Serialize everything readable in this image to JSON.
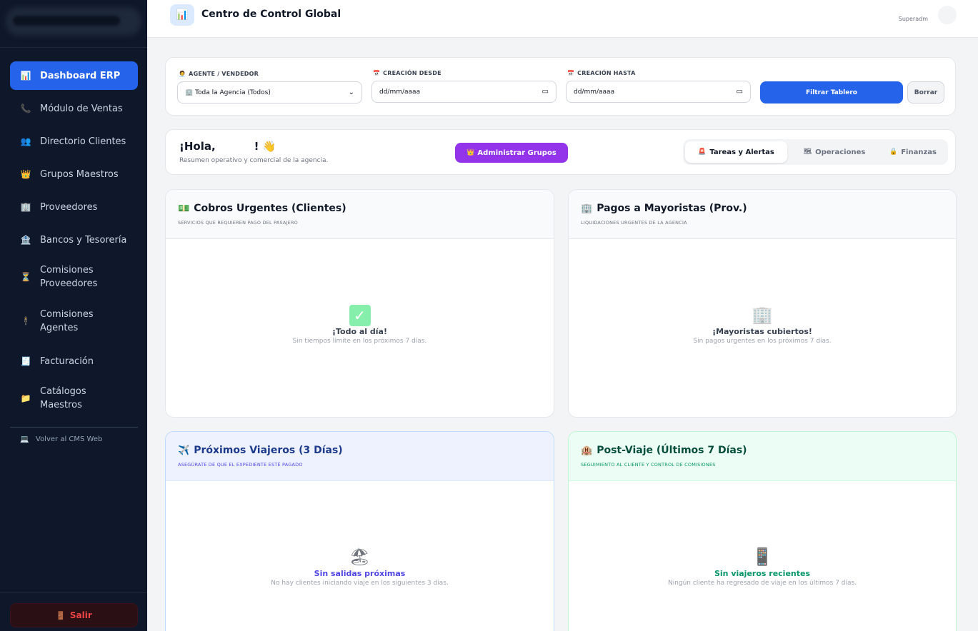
{
  "sidebar": {
    "items": [
      {
        "icon": "bar-chart-icon",
        "glyph": "📊",
        "label": "Dashboard ERP",
        "active": true
      },
      {
        "icon": "phone-icon",
        "glyph": "📞",
        "label": "Módulo de Ventas"
      },
      {
        "icon": "people-icon",
        "glyph": "👥",
        "label": "Directorio Clientes"
      },
      {
        "icon": "crown-icon",
        "glyph": "👑",
        "label": "Grupos Maestros"
      },
      {
        "icon": "building-icon",
        "glyph": "🏢",
        "label": "Proveedores"
      },
      {
        "icon": "bank-icon",
        "glyph": "🏦",
        "label": "Bancos y Tesorería"
      },
      {
        "icon": "hourglass-icon",
        "glyph": "⏳",
        "label": "Comisiones Proveedores"
      },
      {
        "icon": "agent-icon",
        "glyph": "🕴",
        "label": "Comisiones Agentes"
      },
      {
        "icon": "receipt-icon",
        "glyph": "🧾",
        "label": "Facturación"
      },
      {
        "icon": "folder-icon",
        "glyph": "📁",
        "label": "Catálogos Maestros"
      }
    ],
    "back_link": {
      "icon": "computer-icon",
      "glyph": "💻",
      "label": "Volver al CMS Web"
    },
    "logout": {
      "icon": "door-icon",
      "glyph": "🚪",
      "label": "Salir"
    }
  },
  "header": {
    "icon": "bar-chart-icon",
    "glyph": "📊",
    "title": "Centro de Control Global",
    "user_role": "Superadm"
  },
  "filters": {
    "agent_label": "AGENTE / VENDEDOR",
    "agent_glyph": "🧑‍💼",
    "agent_value": "🏢 Toda la Agencia (Todos)",
    "from_label": "CREACIÓN DESDE",
    "from_glyph": "📅",
    "from_placeholder": "dd/mm/aaaa",
    "to_label": "CREACIÓN HASTA",
    "to_glyph": "📅",
    "to_placeholder": "dd/mm/aaaa",
    "filter_button": "Filtrar Tablero",
    "clear_button": "Borrar"
  },
  "greeting": {
    "hello": "¡Hola,",
    "suffix": "!",
    "wave_glyph": "👋",
    "subtitle": "Resumen operativo y comercial de la agencia.",
    "groups_button": "Administrar Grupos",
    "groups_glyph": "👑",
    "tabs": [
      {
        "label": "Tareas y Alertas",
        "glyph": "🚨",
        "active": true
      },
      {
        "label": "Operaciones",
        "glyph": "🗺"
      },
      {
        "label": "Finanzas",
        "glyph": "🔒"
      }
    ]
  },
  "cards": {
    "cobros": {
      "glyph": "💵",
      "title": "Cobros Urgentes (Clientes)",
      "subtitle": "SERVICIOS QUE REQUIEREN PAGO DEL PASAJERO",
      "empty_title": "¡Todo al día!",
      "empty_desc": "Sin tiempos límite en los próximos 7 días.",
      "empty_title_color": "#374151"
    },
    "pagos": {
      "glyph": "🏢",
      "title": "Pagos a Mayoristas (Prov.)",
      "subtitle": "LIQUIDACIONES URGENTES DE LA AGENCIA",
      "empty_glyph": "🏢",
      "empty_title": "¡Mayoristas cubiertos!",
      "empty_desc": "Sin pagos urgentes en los próximos 7 días.",
      "empty_title_color": "#374151"
    },
    "viajeros": {
      "glyph": "✈️",
      "title": "Próximos Viajeros (3 Días)",
      "subtitle": "ASEGÚRATE DE QUE EL EXPEDIENTE ESTÉ PAGADO",
      "empty_glyph": "🏖",
      "empty_title": "Sin salidas próximas",
      "empty_desc": "No hay clientes iniciando viaje en los siguientes 3 días.",
      "empty_title_color": "#4f46e5"
    },
    "postviaje": {
      "glyph": "🏨",
      "title": "Post-Viaje (Últimos 7 Días)",
      "subtitle": "SEGUIMIENTO AL CLIENTE Y CONTROL DE COMISIONES",
      "empty_glyph": "📱",
      "empty_title": "Sin viajeros recientes",
      "empty_desc": "Ningún cliente ha regresado de viaje en los últimos 7 días.",
      "empty_title_color": "#059669"
    }
  },
  "colors": {
    "sidebar_bg": "#0f172a",
    "accent": "#2563eb",
    "purple": "#9333ea",
    "danger": "#ef4444"
  }
}
